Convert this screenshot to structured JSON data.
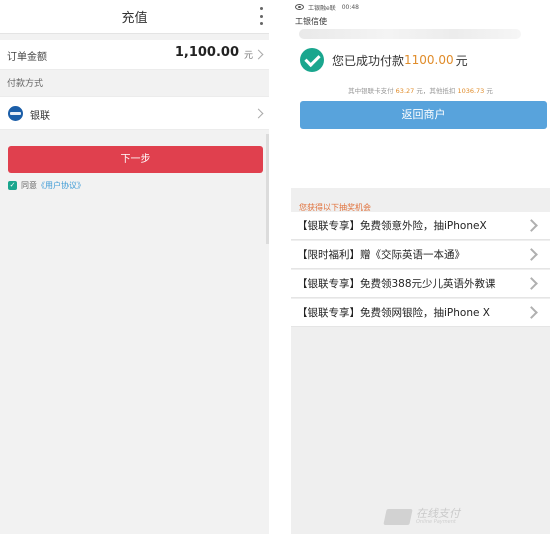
{
  "left_screen": {
    "header": {
      "title": "充值"
    },
    "order": {
      "label": "订单金额",
      "amount": "1,100.00",
      "unit": "元"
    },
    "payment": {
      "section_label": "付款方式",
      "method_label": "银联"
    },
    "next_button": {
      "label": "下一步"
    },
    "agreement": {
      "prefix": "同意",
      "link": "《用户协议》"
    }
  },
  "right_screen": {
    "status_bar": {
      "app": "工银融e联",
      "time": "00:48"
    },
    "app_title": "工银信使",
    "success": {
      "text": "您已成功付款",
      "amount": "1100.00",
      "unit": "元",
      "detail_prefix": "其中银联卡支付",
      "detail_card_amount": "63.27",
      "detail_mid": "元，其他抵扣",
      "detail_other_amount": "1036.73",
      "detail_suffix": "元"
    },
    "return_button": {
      "label": "返回商户"
    },
    "lottery": {
      "heading": "您获得以下抽奖机会",
      "items": [
        "【银联专享】免费领意外险，抽iPhoneX",
        "【限时福利】赠《交际英语一本通》",
        "【银联专享】免费领388元少儿英语外教课",
        "【银联专享】免费领网银险，抽iPhone X"
      ]
    },
    "watermark": {
      "cn": "在线支付",
      "en": "Online Payment"
    }
  },
  "colors": {
    "primary_red": "#e0404e",
    "success_green": "#1aa68e",
    "return_blue": "#58a3dc",
    "amount_orange": "#e08c2a",
    "link_blue": "#3d9bd6"
  },
  "icons": [
    "more-vertical-icon",
    "chevron-right-icon",
    "unionpay-icon",
    "checkbox-checked-icon",
    "success-check-icon",
    "eye-icon",
    "unionpay-watermark-icon"
  ]
}
